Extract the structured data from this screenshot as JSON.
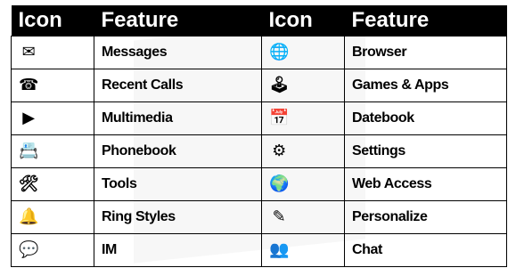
{
  "table": {
    "headers": [
      "Icon",
      "Feature",
      "Icon",
      "Feature"
    ],
    "rows": [
      {
        "left": {
          "icon": "envelope-icon",
          "glyph": "✉",
          "feature": "Messages"
        },
        "right": {
          "icon": "globe-icon",
          "glyph": "🌐",
          "feature": "Browser"
        }
      },
      {
        "left": {
          "icon": "phone-clock-icon",
          "glyph": "☎",
          "feature": "Recent Calls"
        },
        "right": {
          "icon": "joystick-icon",
          "glyph": "🕹",
          "feature": "Games & Apps"
        }
      },
      {
        "left": {
          "icon": "film-play-icon",
          "glyph": "▶",
          "feature": "Multimedia"
        },
        "right": {
          "icon": "calendar-icon",
          "glyph": "📅",
          "feature": "Datebook"
        }
      },
      {
        "left": {
          "icon": "address-book-icon",
          "glyph": "📇",
          "feature": "Phonebook"
        },
        "right": {
          "icon": "tools-settings-icon",
          "glyph": "⚙",
          "feature": "Settings"
        }
      },
      {
        "left": {
          "icon": "tools-clock-icon",
          "glyph": "🛠",
          "feature": "Tools"
        },
        "right": {
          "icon": "web-access-icon",
          "glyph": "🌍",
          "feature": "Web Access"
        }
      },
      {
        "left": {
          "icon": "bell-icon",
          "glyph": "🔔",
          "feature": "Ring Styles"
        },
        "right": {
          "icon": "personalize-icon",
          "glyph": "✎",
          "feature": "Personalize"
        }
      },
      {
        "left": {
          "icon": "im-chat-bubble-icon",
          "glyph": "💬",
          "feature": "IM"
        },
        "right": {
          "icon": "chat-people-icon",
          "glyph": "👥",
          "feature": "Chat"
        }
      }
    ]
  }
}
